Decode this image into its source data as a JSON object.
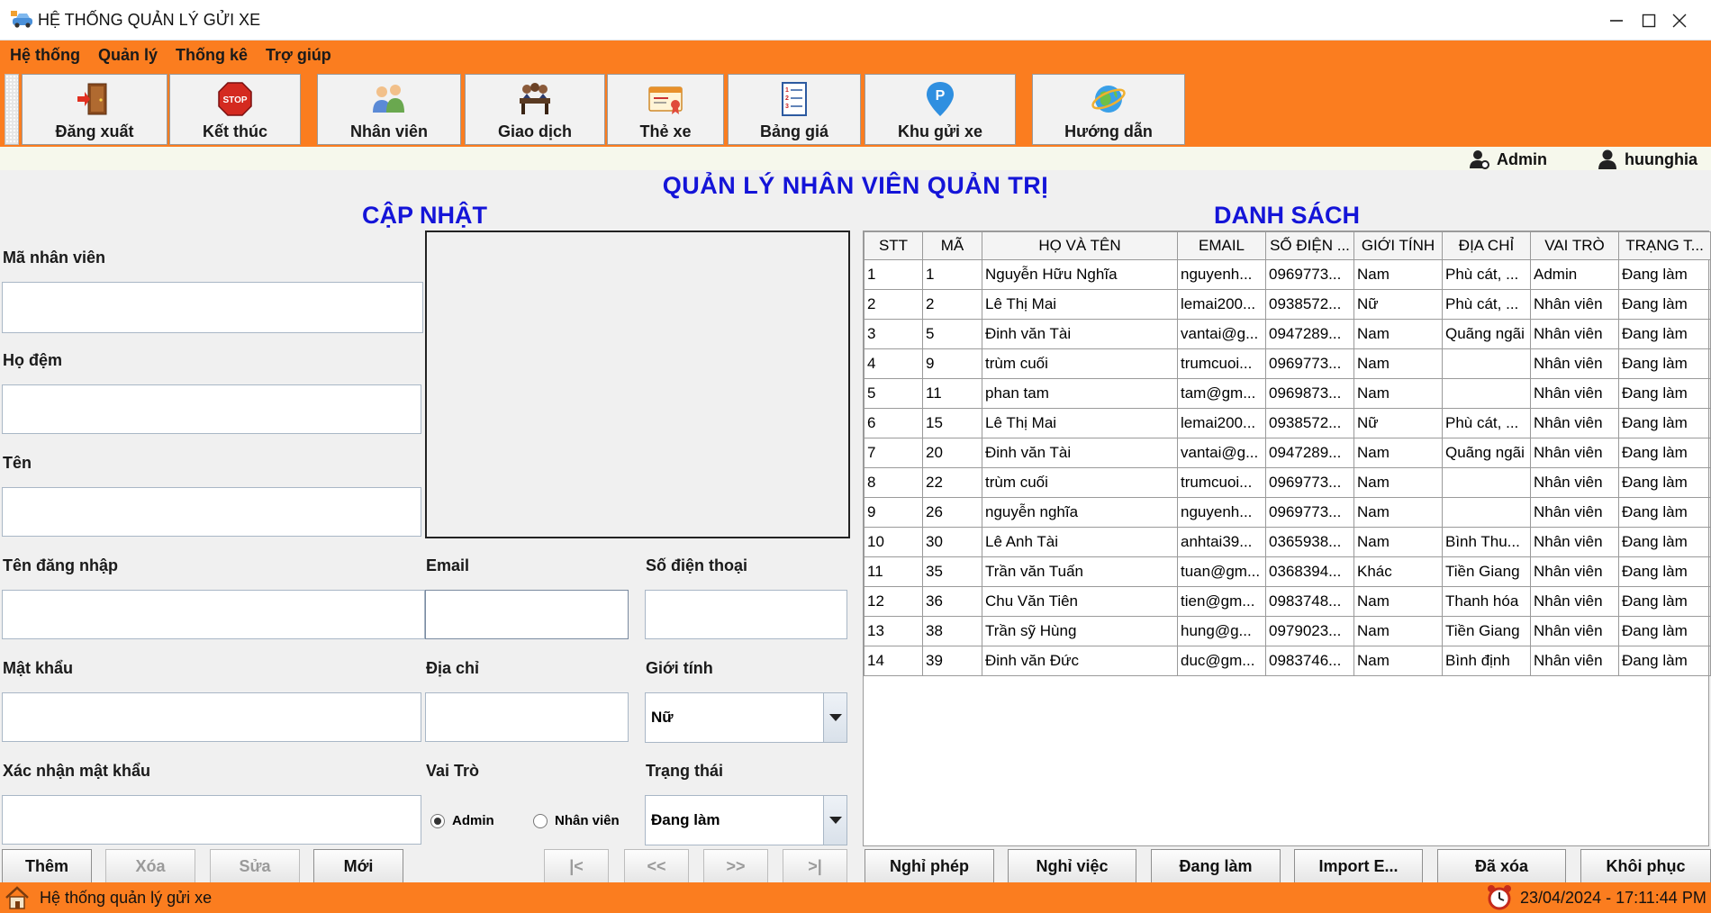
{
  "window": {
    "title": "HỆ THỐNG QUẢN LÝ GỬI XE"
  },
  "menu": [
    "Hệ thống",
    "Quản lý",
    "Thống kê",
    "Trợ giúp"
  ],
  "toolbar": {
    "logout": "Đăng xuất",
    "exit": "Kết thúc",
    "staff": "Nhân viên",
    "transactions": "Giao dịch",
    "cards": "Thẻ xe",
    "prices": "Bảng giá",
    "parking": "Khu gửi xe",
    "guide": "Hướng dẫn"
  },
  "users": {
    "role": "Admin",
    "username": "huunghia"
  },
  "page_title": "QUẢN LÝ NHÂN VIÊN QUẢN TRỊ",
  "form": {
    "section_title": "CẬP NHẬT",
    "labels": {
      "id": "Mã nhân viên",
      "lastname": "Họ đệm",
      "firstname": "Tên",
      "login": "Tên đăng nhập",
      "email": "Email",
      "phone": "Số điện thoại",
      "password": "Mật khẩu",
      "address": "Địa chỉ",
      "gender": "Giới tính",
      "confirm": "Xác nhận mật khẩu",
      "role": "Vai Trò",
      "status": "Trạng thái"
    },
    "gender_value": "Nữ",
    "status_value": "Đang làm",
    "role_options": {
      "admin": "Admin",
      "staff": "Nhân viên"
    },
    "role_selected": "Admin",
    "buttons": {
      "add": "Thêm",
      "delete": "Xóa",
      "edit": "Sửa",
      "new": "Mới"
    },
    "nav": {
      "first": "|<",
      "prev": "<<",
      "next": ">>",
      "last": ">|"
    }
  },
  "list": {
    "section_title": "DANH SÁCH",
    "columns": [
      "STT",
      "MÃ",
      "HỌ VÀ TÊN",
      "EMAIL",
      "SỐ ĐIỆN ...",
      "GIỚI TÍNH",
      "ĐỊA CHỈ",
      "VAI TRÒ",
      "TRẠNG T..."
    ],
    "rows": [
      [
        "1",
        "1",
        "Nguyễn Hữu Nghĩa",
        "nguyenh...",
        "0969773...",
        "Nam",
        "Phù cát, ...",
        "Admin",
        "Đang làm"
      ],
      [
        "2",
        "2",
        "Lê Thị Mai",
        "lemai200...",
        "0938572...",
        "Nữ",
        "Phù cát, ...",
        "Nhân viên",
        "Đang làm"
      ],
      [
        "3",
        "5",
        "Đinh văn Tài",
        "vantai@g...",
        "0947289...",
        "Nam",
        "Quãng ngãi",
        "Nhân viên",
        "Đang làm"
      ],
      [
        "4",
        "9",
        "trùm cuối",
        "trumcuoi...",
        "0969773...",
        "Nam",
        "",
        "Nhân viên",
        "Đang làm"
      ],
      [
        "5",
        "11",
        "phan tam",
        "tam@gm...",
        "0969873...",
        "Nam",
        "",
        "Nhân viên",
        "Đang làm"
      ],
      [
        "6",
        "15",
        "Lê Thị Mai",
        "lemai200...",
        "0938572...",
        "Nữ",
        "Phù cát, ...",
        "Nhân viên",
        "Đang làm"
      ],
      [
        "7",
        "20",
        "Đinh văn Tài",
        "vantai@g...",
        "0947289...",
        "Nam",
        "Quãng ngãi",
        "Nhân viên",
        "Đang làm"
      ],
      [
        "8",
        "22",
        "trùm cuối",
        "trumcuoi...",
        "0969773...",
        "Nam",
        "",
        "Nhân viên",
        "Đang làm"
      ],
      [
        "9",
        "26",
        "nguyễn nghĩa",
        "nguyenh...",
        "0969773...",
        "Nam",
        "",
        "Nhân viên",
        "Đang làm"
      ],
      [
        "10",
        "30",
        "Lê Anh Tài",
        "anhtai39...",
        "0365938...",
        "Nam",
        "Bình Thu...",
        "Nhân viên",
        "Đang làm"
      ],
      [
        "11",
        "35",
        "Trần văn Tuấn",
        "tuan@gm...",
        "0368394...",
        "Khác",
        "Tiền Giang",
        "Nhân viên",
        "Đang làm"
      ],
      [
        "12",
        "36",
        "Chu Văn Tiên",
        "tien@gm...",
        "0983748...",
        "Nam",
        "Thanh hóa",
        "Nhân viên",
        "Đang làm"
      ],
      [
        "13",
        "38",
        "Trần sỹ Hùng",
        "hung@g...",
        "0979023...",
        "Nam",
        "Tiền Giang",
        "Nhân viên",
        "Đang làm"
      ],
      [
        "14",
        "39",
        "Đinh văn Đức",
        "duc@gm...",
        "0983746...",
        "Nam",
        "Bình định",
        "Nhân viên",
        "Đang làm"
      ]
    ],
    "buttons": {
      "leave": "Nghỉ phép",
      "quit": "Nghỉ việc",
      "working": "Đang làm",
      "import": "Import E...",
      "deleted": "Đã xóa",
      "restore": "Khôi phục"
    }
  },
  "status": {
    "app": "Hệ thống quản lý gửi xe",
    "datetime": "23/04/2024 - 17:11:44 PM"
  },
  "colors": {
    "accent": "#fb7d1f",
    "heading": "#1414d8"
  }
}
